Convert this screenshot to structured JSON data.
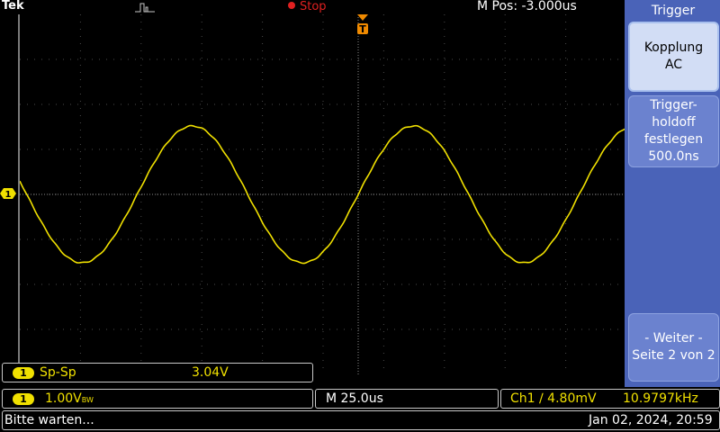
{
  "header": {
    "brand": "Tek",
    "run_state": "Stop",
    "position_readout": "M Pos: -3.000us",
    "trigger_marker_label": "T"
  },
  "channel_marker": {
    "label": "1"
  },
  "side_menu": {
    "title": "Trigger",
    "coupling": {
      "line1": "Kopplung",
      "line2": "AC"
    },
    "holdoff": {
      "line1": "Trigger-",
      "line2": "holdoff",
      "line3": "festlegen",
      "line4": "500.0ns"
    },
    "more": {
      "line1": "- Weiter -",
      "line2": "Seite 2 von 2"
    }
  },
  "measurement": {
    "channel": "1",
    "name": "Sp-Sp",
    "value": "3.04V"
  },
  "bottom": {
    "channel": "1",
    "vscale": "1.00V",
    "bw_suffix": "BW",
    "timebase": "M 25.0us",
    "trigger": "Ch1 ∕ 4.80mV",
    "frequency": "10.9797kHz"
  },
  "status": {
    "message": "Bitte warten...",
    "datetime": "Jan 02, 2024, 20:59"
  },
  "colors": {
    "trace": "#f0e000",
    "menu_bg": "#4a63b8",
    "stop": "#e02020"
  },
  "waveform": {
    "type": "sine",
    "frequency_khz": 10.9797,
    "peak_to_peak_v": 3.04,
    "volts_per_div": 1.0,
    "time_per_div_us": 25.0
  }
}
